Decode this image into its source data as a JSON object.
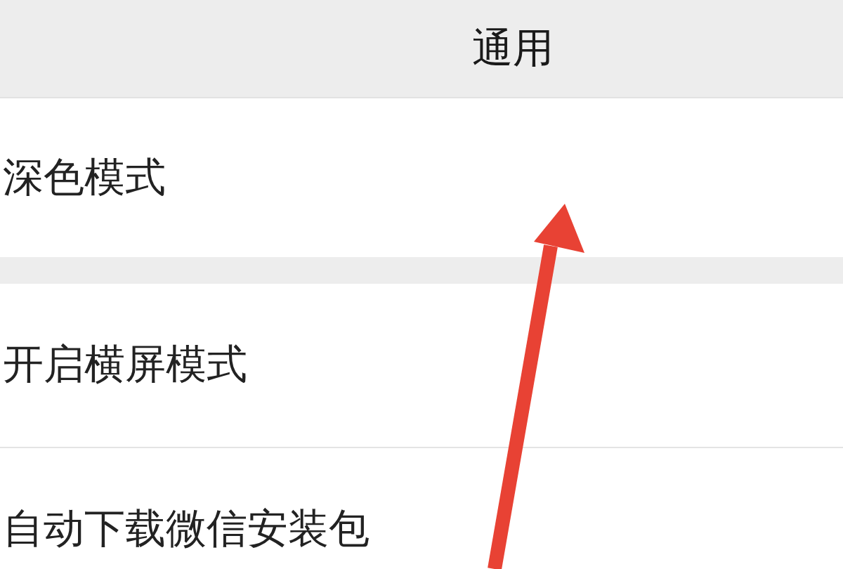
{
  "header": {
    "title": "通用"
  },
  "groups": [
    {
      "items": [
        {
          "label": "深色模式"
        }
      ]
    },
    {
      "items": [
        {
          "label": "开启横屏模式"
        },
        {
          "label": "自动下载微信安装包"
        }
      ]
    }
  ]
}
